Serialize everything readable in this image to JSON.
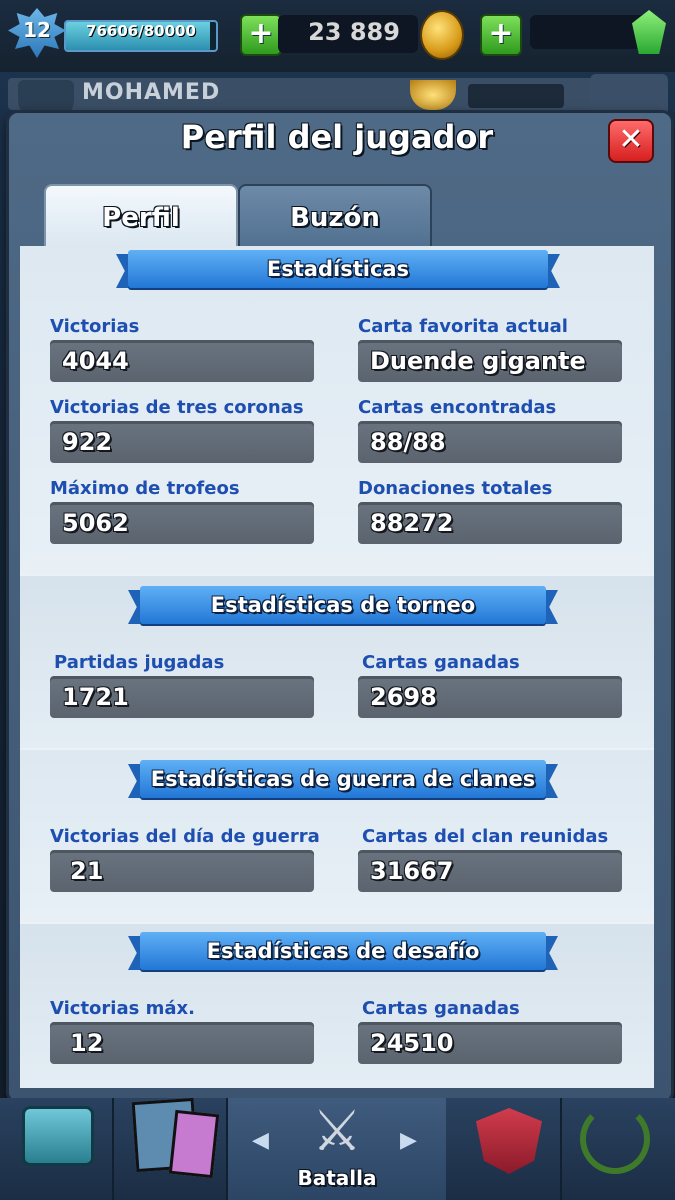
{
  "top_bar": {
    "level": "12",
    "xp_text": "76606/80000",
    "xp_progress": 0.958,
    "gold": "23 889",
    "gold_plus": "+",
    "gems_plus": "+"
  },
  "background_header": {
    "player_name": "MOHAMED"
  },
  "modal": {
    "title": "Perfil del jugador",
    "close_glyph": "✕",
    "tabs": [
      {
        "label": "Perfil",
        "active": true
      },
      {
        "label": "Buzón",
        "active": false
      }
    ],
    "sections": [
      {
        "title": "Estadísticas",
        "stats": [
          {
            "label": "Victorias",
            "value": "4044"
          },
          {
            "label": "Carta favorita actual",
            "value": "Duende gigante"
          },
          {
            "label": "Victorias de tres coronas",
            "value": "922"
          },
          {
            "label": "Cartas encontradas",
            "value": "88/88"
          },
          {
            "label": "Máximo de trofeos",
            "value": "5062"
          },
          {
            "label": "Donaciones totales",
            "value": "88272"
          }
        ]
      },
      {
        "title": "Estadísticas de torneo",
        "stats": [
          {
            "label": "Partidas jugadas",
            "value": "1721"
          },
          {
            "label": "Cartas ganadas",
            "value": "2698"
          }
        ]
      },
      {
        "title": "Estadísticas de guerra de clanes",
        "stats": [
          {
            "label": "Victorias del día de guerra",
            "value": "21"
          },
          {
            "label": "Cartas del clan reunidas",
            "value": "31667"
          }
        ]
      },
      {
        "title": "Estadísticas de desafío",
        "stats": [
          {
            "label": "Victorias máx.",
            "value": "12"
          },
          {
            "label": "Cartas ganadas",
            "value": "24510"
          }
        ]
      }
    ]
  },
  "bottom_nav": {
    "battle_label": "Batalla",
    "arrow_left": "◀",
    "arrow_right": "▶",
    "swords_glyph": "⚔",
    "icons": [
      "shop-chest-icon",
      "cards-icon",
      "battle-swords-icon",
      "clan-shield-icon",
      "tournament-laurel-icon"
    ]
  },
  "colors": {
    "label_blue": "#1e4fb0",
    "ribbon_blue": "#2f88e6",
    "close_red": "#e03131",
    "plus_green": "#4cbf2e"
  }
}
